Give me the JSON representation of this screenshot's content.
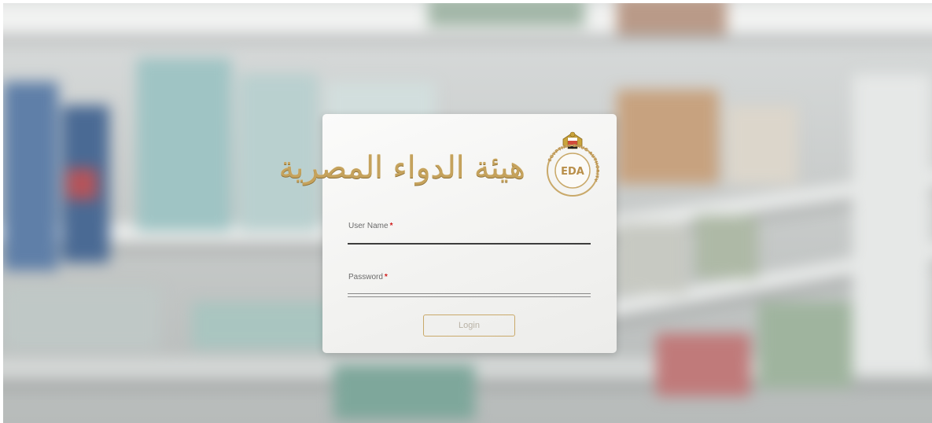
{
  "header": {
    "arabic_title": "هيئة الدواء المصرية",
    "logo_text": "EDA",
    "logo_ring_text": "EGYPTIAN DRUG AUTHORITY"
  },
  "form": {
    "username_label": "User Name",
    "username_value": "",
    "password_label": "Password",
    "password_value": "",
    "required_marker": "*",
    "login_label": "Login"
  },
  "colors": {
    "accent_gold": "#c9a96a",
    "required_red": "#d11a1a"
  }
}
